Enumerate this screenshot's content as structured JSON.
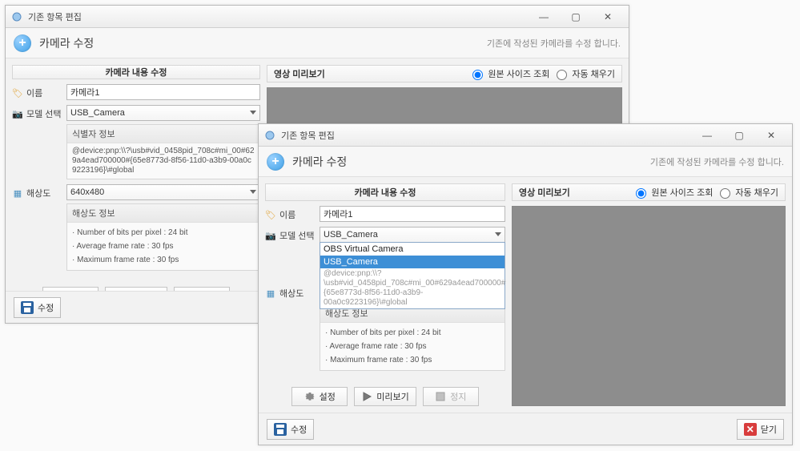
{
  "window": {
    "title": "기존 항목 편집",
    "minimize": "—",
    "maximize": "▢",
    "close": "✕"
  },
  "subheader": {
    "title": "카메라 수정",
    "desc": "기존에 작성된 카메라를 수정 합니다."
  },
  "left": {
    "section_title": "카메라 내용 수정",
    "labels": {
      "name": "이름",
      "model": "모델 선택",
      "resolution": "해상도"
    },
    "name_value": "카메라1",
    "model_value": "USB_Camera",
    "model_options": {
      "opt1": "OBS Virtual Camera",
      "opt2": "USB_Camera"
    },
    "identifier": {
      "title": "식별자 정보",
      "path": "@device:pnp:\\\\?\\usb#vid_0458pid_708c#mi_00#629a4ead700000#{65e8773d-8f56-11d0-a3b9-00a0c9223196}\\#global"
    },
    "resolution_value": "640x480",
    "res_info": {
      "title": "해상도 정보",
      "l1": "· Number of bits per pixel : 24 bit",
      "l2": "· Average frame rate : 30 fps",
      "l3": "· Maximum frame rate : 30 fps"
    },
    "buttons": {
      "settings": "설정",
      "preview": "미리보기",
      "stop": "정지"
    }
  },
  "right": {
    "section_title": "영상 미리보기",
    "radio1": "원본 사이즈 조회",
    "radio2": "자동 채우기"
  },
  "footer": {
    "save": "수정",
    "close": "닫기"
  }
}
